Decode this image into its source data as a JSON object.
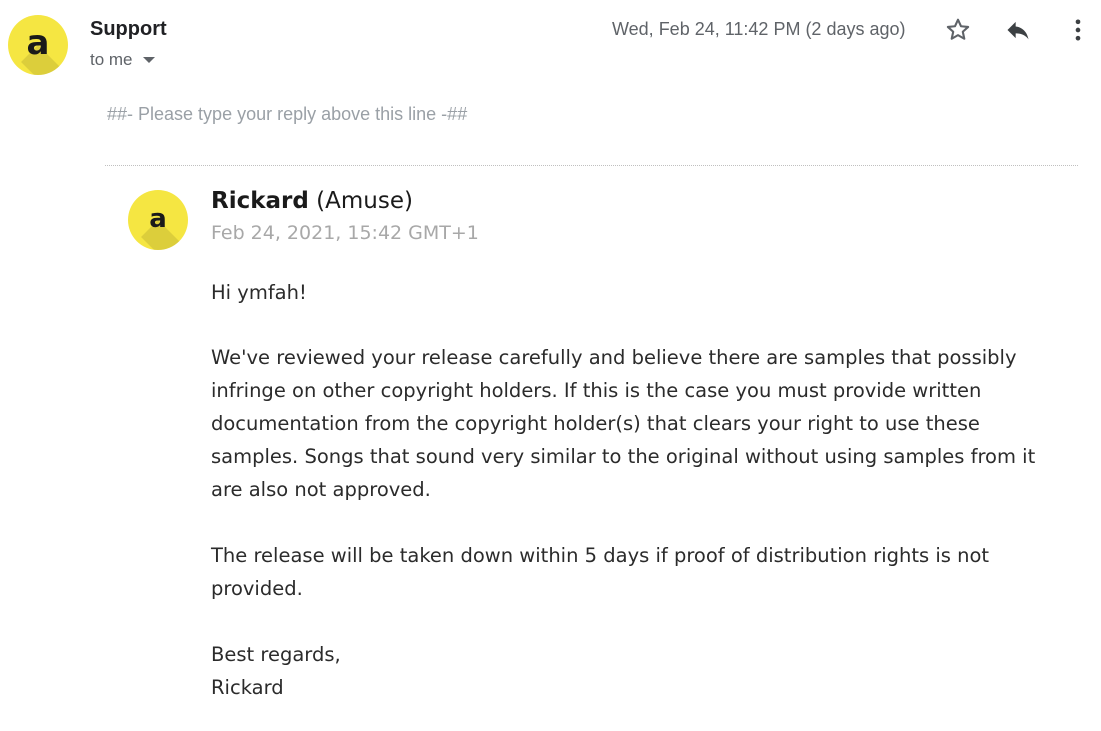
{
  "header": {
    "avatar_letter": "a",
    "sender": "Support",
    "recipient": "to me",
    "timestamp": "Wed, Feb 24, 11:42 PM (2 days ago)"
  },
  "reply_marker": "##- Please type your reply above this line -##",
  "quoted": {
    "avatar_letter": "a",
    "author_name": "Rickard",
    "author_org": "(Amuse)",
    "date": "Feb 24, 2021, 15:42 GMT+1",
    "greeting": "Hi ymfah!",
    "paragraph_lines": [
      "We've reviewed your release carefully and believe there are samples that possibly",
      "infringe on other copyright holders. If this is the case you must provide written",
      "documentation from the copyright holder(s) that clears your right to use these",
      "samples. Songs that sound very similar to the original without using samples from it",
      "are also not approved."
    ],
    "takedown_lines": [
      "The release will be taken down within 5 days if proof of distribution rights is not",
      "provided."
    ],
    "closing": "Best regards,",
    "signature": "Rickard"
  },
  "colors": {
    "avatar_yellow": "#f5e642",
    "muted_text": "#5f6368",
    "faint_text": "#9aa0a6"
  },
  "icons": {
    "star": "star-icon",
    "reply": "reply-icon",
    "more": "more-vert-icon",
    "caret": "caret-down-icon"
  }
}
